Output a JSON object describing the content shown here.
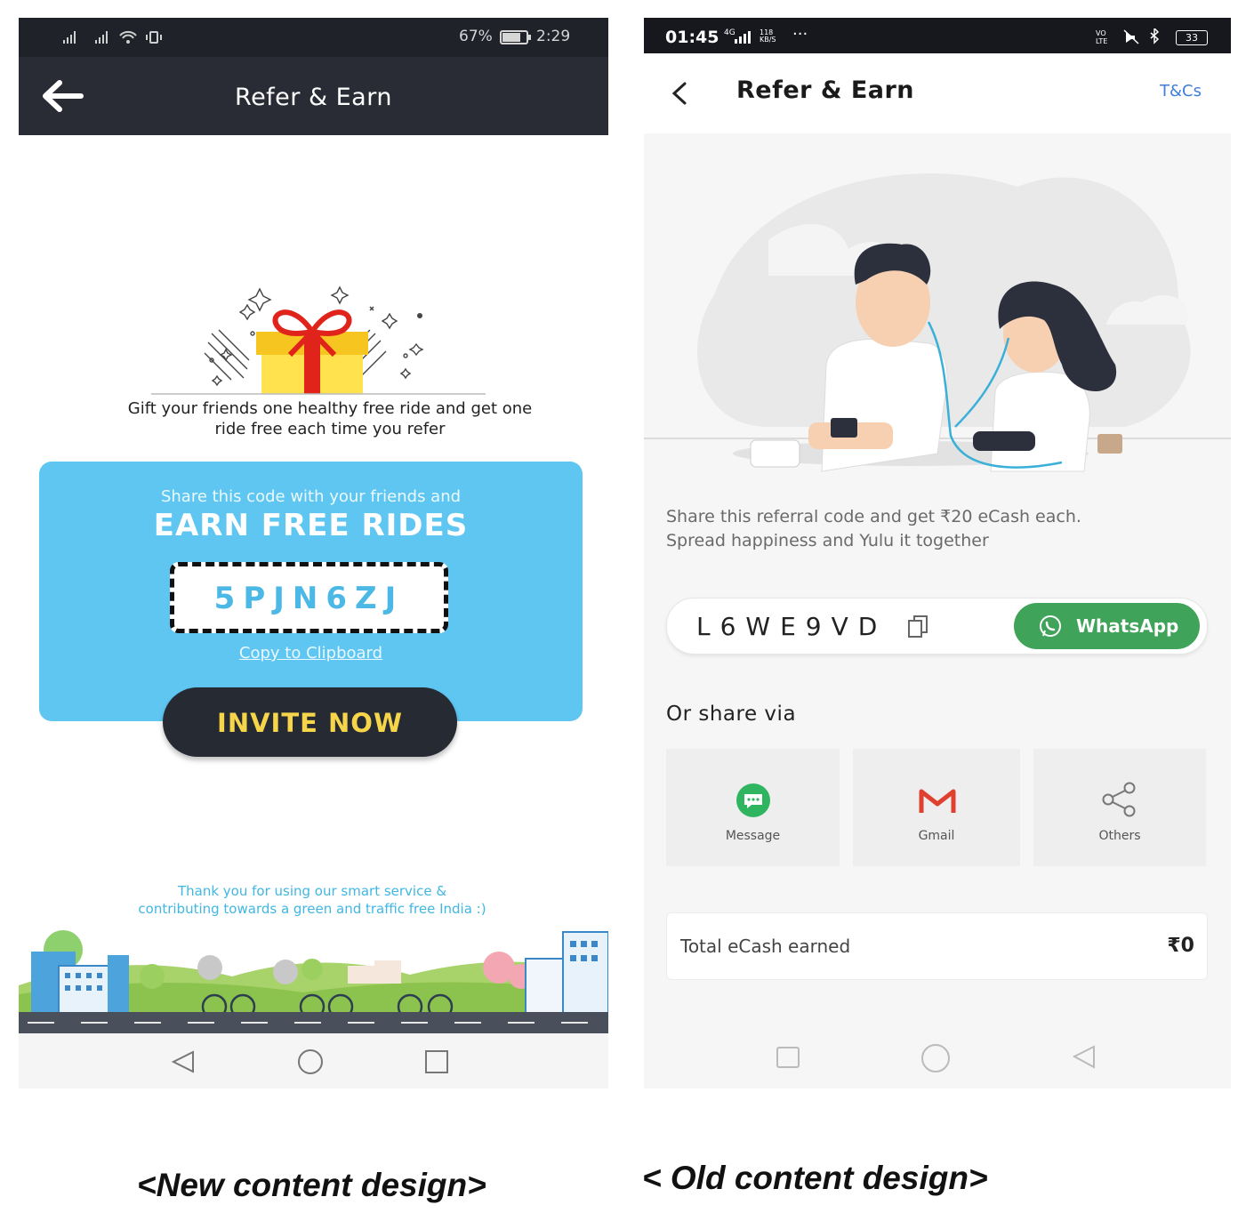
{
  "new_design": {
    "status": {
      "battery": "67%",
      "time": "2:29"
    },
    "title": "Refer & Earn",
    "gift_caption_line1": "Gift your friends one healthy free ride and get one",
    "gift_caption_line2": "ride free each time you refer",
    "card_line1": "Share this code with your friends and",
    "card_line2": "EARN FREE RIDES",
    "code": "5PJN6ZJ",
    "copy_link": "Copy to Clipboard",
    "invite_button": "INVITE NOW",
    "thanks_line1": "Thank you for using our smart service &",
    "thanks_line2": "contributing towards a green and traffic free India :)",
    "caption": "<New content design>"
  },
  "old_design": {
    "status": {
      "time": "01:45",
      "net": "4G",
      "speed": "118 KB/S",
      "battery": "33"
    },
    "title": "Refer & Earn",
    "tcs_link": "T&Cs",
    "referral_line1": "Share this referral code and get ₹20 eCash each.",
    "referral_line2": "Spread happiness and Yulu it together",
    "code": "L6WE9VD",
    "whatsapp_button": "WhatsApp",
    "or_share": "Or share via",
    "share_options": [
      {
        "label": "Message",
        "icon": "message-icon"
      },
      {
        "label": "Gmail",
        "icon": "gmail-icon"
      },
      {
        "label": "Others",
        "icon": "share-icon"
      }
    ],
    "ecash_label": "Total eCash earned",
    "ecash_value": "₹0",
    "caption": "< Old content design>"
  },
  "colors": {
    "accent_blue": "#5fc6f2",
    "invite_yellow": "#f6d54a",
    "whatsapp_green": "#40a35a",
    "dark_bar": "#292c35"
  }
}
